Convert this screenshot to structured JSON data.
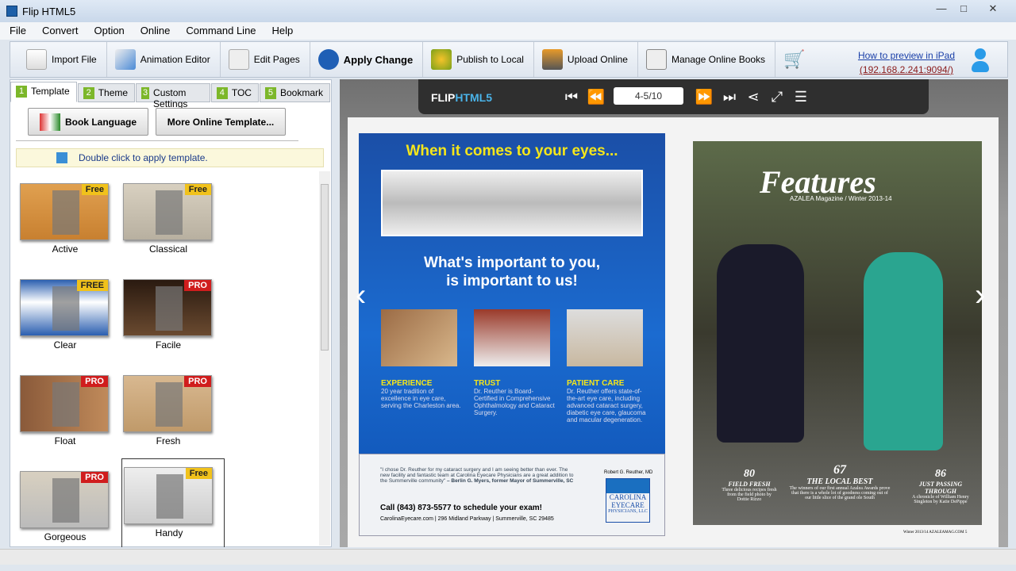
{
  "window": {
    "title": "Flip HTML5",
    "min": "—",
    "max": "□",
    "close": "✕"
  },
  "menu": [
    "File",
    "Convert",
    "Option",
    "Online",
    "Command Line",
    "Help"
  ],
  "toolbar": {
    "items": [
      "Import File",
      "Animation Editor",
      "Edit Pages",
      "Apply Change",
      "Publish to Local",
      "Upload Online",
      "Manage Online Books"
    ],
    "ipad_link": "How to preview in iPad",
    "ipad_address": "(192.168.2.241:9094/)"
  },
  "tabs": [
    {
      "n": "1",
      "label": "Template"
    },
    {
      "n": "2",
      "label": "Theme"
    },
    {
      "n": "3",
      "label": "Custom Settings"
    },
    {
      "n": "4",
      "label": "TOC"
    },
    {
      "n": "5",
      "label": "Bookmark"
    }
  ],
  "buttons": {
    "book_language": "Book Language",
    "more_templates": "More Online Template..."
  },
  "info": "Double click to apply template.",
  "templates": [
    {
      "name": "Active",
      "badge": "Free"
    },
    {
      "name": "Classical",
      "badge": "Free"
    },
    {
      "name": "Clear",
      "badge": "FREE"
    },
    {
      "name": "Facile",
      "badge": "PRO"
    },
    {
      "name": "Float",
      "badge": "PRO"
    },
    {
      "name": "Fresh",
      "badge": "PRO"
    },
    {
      "name": "Gorgeous",
      "badge": "PRO"
    },
    {
      "name": "Handy",
      "badge": "Free"
    }
  ],
  "viewer": {
    "logo_a": "FLIP",
    "logo_b": "HTML5",
    "page": "4-5/10"
  },
  "left_page": {
    "headline": "When it comes to your eyes...",
    "sub1": "What's important to you,",
    "sub2": "is important to us!",
    "cols": [
      {
        "h": "EXPERIENCE",
        "t": "20 year tradition of excellence in eye care, serving the Charleston area."
      },
      {
        "h": "TRUST",
        "t": "Dr. Reuther is Board-Certified in Comprehensive Ophthalmology and Cataract Surgery."
      },
      {
        "h": "PATIENT CARE",
        "t": "Dr. Reuther offers state-of-the-art eye care, including advanced cataract surgery, diabetic eye care, glaucoma and macular degeneration."
      }
    ],
    "quote": "\"I chose Dr. Reuther for my cataract surgery and I am seeing better than ever. The new facility and fantastic team at Carolina Eyecare Physicians are a great addition to the Summerville community\"",
    "quote_by": "– Berlin G. Myers, former Mayor of Summerville, SC",
    "call": "Call (843) 873-5577 to schedule your exam!",
    "address": "CarolinaEyecare.com | 296 Midland Parkway | Summerville, SC 29485",
    "doctor": "Robert G. Reuther, MD",
    "logo1": "CAROLINA",
    "logo2": "EYECARE",
    "logo3": "PHYSICIANS, LLC"
  },
  "right_page": {
    "title": "Features",
    "subtitle": "AZALEA Magazine / Winter 2013-14",
    "items": [
      {
        "num": "80",
        "h": "FIELD FRESH",
        "t": "Three delicious recipes fresh from the field photo by Dottie Rizzo"
      },
      {
        "num": "67",
        "h": "THE LOCAL BEST",
        "t": "The winners of our first annual Azalea Awards prove that there is a whole lot of goodness coming out of our little slice of the grand ole South"
      },
      {
        "num": "86",
        "h": "JUST PASSING THROUGH",
        "t": "A chronicle of William Henry Singleton by Katie DePippe"
      }
    ],
    "footer": "Winter 2013/14 AZALEAMAG.COM 5"
  }
}
